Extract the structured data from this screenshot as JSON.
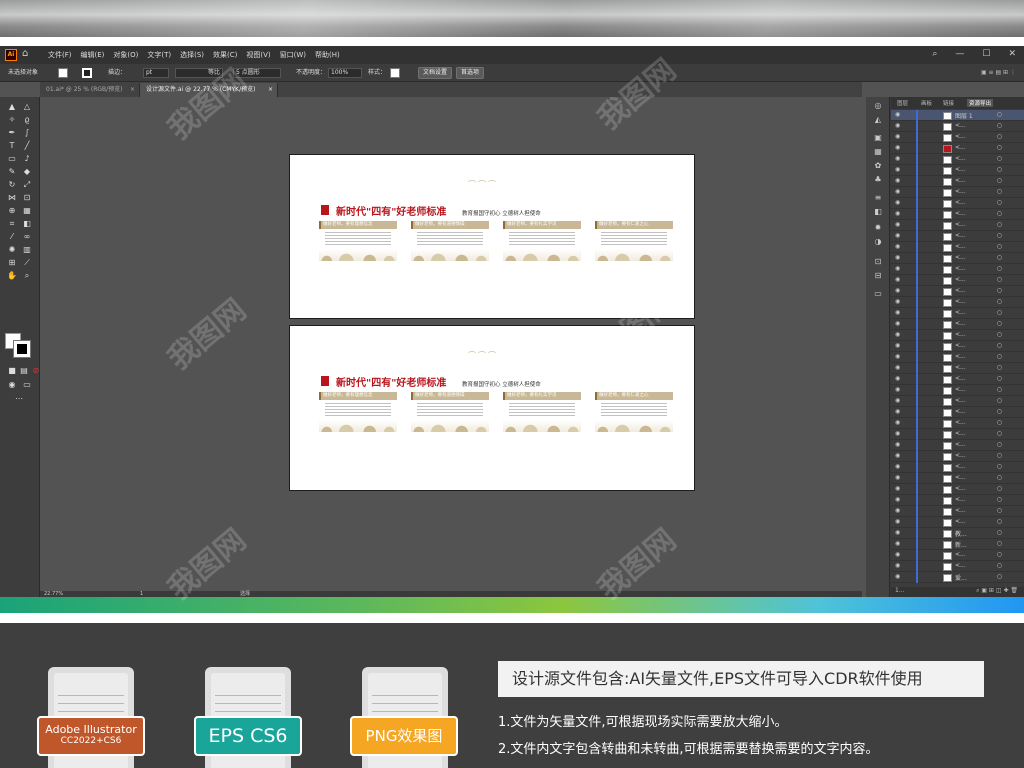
{
  "app": {
    "logo": "Ai",
    "menus": [
      "文件(F)",
      "编辑(E)",
      "对象(O)",
      "文字(T)",
      "选择(S)",
      "效果(C)",
      "视图(V)",
      "窗口(W)",
      "帮助(H)"
    ]
  },
  "control_bar": {
    "selection": "未选择对象",
    "stroke_label": "描边：",
    "stroke_value": "pt",
    "profile_label": "等比",
    "brush_label": "5 点圆形",
    "opacity_label": "不透明度：",
    "opacity_value": "100%",
    "style_label": "样式：",
    "doc_setup_button": "文档设置",
    "prefs_button": "首选项"
  },
  "tabs": [
    {
      "label": "01.ai* @ 25 % (RGB/预览)",
      "close": "×"
    },
    {
      "label": "设计源文件.ai @ 22.77 % (CMYK/预览)",
      "close": "×"
    }
  ],
  "artboard": {
    "title": "新时代\"四有\"好老师标准",
    "subtitle": "教育报国守初心  立德树人担使命",
    "cards": [
      "做好老师，要有理想信念",
      "做好老师，要有道德情操",
      "做好老师，要有扎实学识",
      "做好老师，要有仁爱之心"
    ]
  },
  "status": {
    "zoom": "22.77%",
    "page": "1",
    "mode": "选择"
  },
  "layers_panel": {
    "tabs": [
      "图层",
      "画板",
      "链接",
      "资源导出"
    ],
    "top_layer": "图层 1",
    "row_label": "<...",
    "row_labels_extra": [
      "教...",
      "新...",
      "爱...",
      "做..."
    ]
  },
  "info": {
    "box_title": "设计源文件包含:AI矢量文件,EPS文件可导入CDR软件使用",
    "lines": [
      "1.文件为矢量文件,可根据现场实际需要放大缩小。",
      "2.文件内文字包含转曲和未转曲,可根据需要替换需要的文字内容。"
    ],
    "badges": [
      {
        "line1": "Adobe Illustrator",
        "line2": "CC2022+CS6",
        "color": "#c0572a"
      },
      {
        "line1": "EPS CS6",
        "color": "#1aa59a"
      },
      {
        "line1": "PNG效果图",
        "color": "#f5a623"
      }
    ]
  },
  "watermark": "我图网"
}
